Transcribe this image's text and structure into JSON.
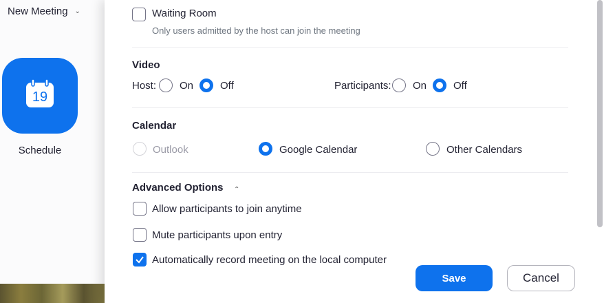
{
  "background_app": {
    "new_meeting_label": "New Meeting",
    "schedule_label": "Schedule",
    "calendar_day": "19",
    "accent_color": "#0e72ed"
  },
  "dialog": {
    "waiting_room": {
      "label": "Waiting Room",
      "description": "Only users admitted by the host can join the meeting",
      "checked": false
    },
    "video": {
      "heading": "Video",
      "host_label": "Host:",
      "participants_label": "Participants:",
      "on_label": "On",
      "off_label": "Off",
      "host_value": "Off",
      "participants_value": "Off"
    },
    "calendar": {
      "heading": "Calendar",
      "options": [
        "Outlook",
        "Google Calendar",
        "Other Calendars"
      ],
      "selected": "Google Calendar"
    },
    "advanced": {
      "heading": "Advanced Options",
      "options": [
        {
          "label": "Allow participants to join anytime",
          "checked": false
        },
        {
          "label": "Mute participants upon entry",
          "checked": false
        },
        {
          "label": "Automatically record meeting on the local computer",
          "checked": true
        }
      ]
    },
    "save_label": "Save",
    "cancel_label": "Cancel"
  }
}
